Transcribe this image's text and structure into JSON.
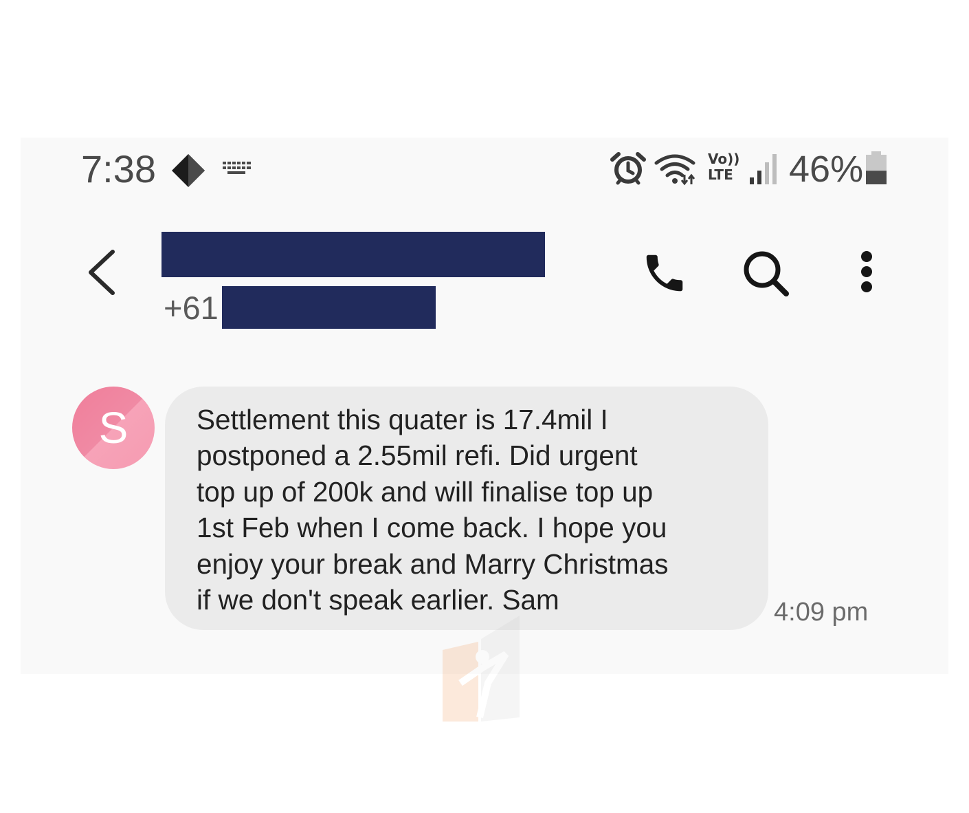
{
  "status_bar": {
    "time": "7:38",
    "battery_percent": "46%",
    "battery_level": 0.46,
    "icons": [
      "diamond-icon",
      "keyboard-icon",
      "alarm-icon",
      "wifi-icon",
      "volte-icon",
      "signal-icon",
      "battery-icon"
    ],
    "volte_top": "Vo))",
    "volte_bottom": "LTE"
  },
  "header": {
    "number_prefix": "+61",
    "icons": [
      "back-icon",
      "phone-icon",
      "search-icon",
      "more-vertical-icon"
    ]
  },
  "conversation": {
    "messages": [
      {
        "avatar_letter": "S",
        "text": "Settlement this quater is 17.4mil I\npostponed a 2.55mil refi. Did urgent\ntop up of 200k and will finalise top up\n1st Feb when I come back. I hope you\nenjoy your break and Marry Christmas\nif we don't speak earlier. Sam",
        "time": "4:09 pm"
      }
    ]
  },
  "colors": {
    "redaction": "#212b5c",
    "bubble": "#ebebeb",
    "avatar": "#f08aa4",
    "background": "#f9f9f9"
  }
}
